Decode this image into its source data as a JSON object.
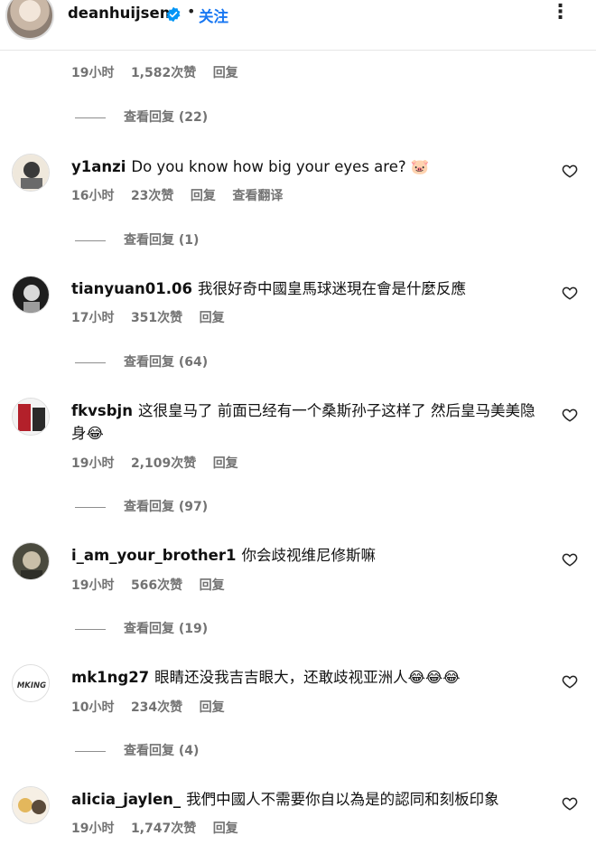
{
  "header": {
    "username": "deanhuijsen",
    "separator": "•",
    "follow_label": "关注",
    "more_icon": "more-icon"
  },
  "top_meta": {
    "time": "19小时",
    "likes": "1,582次赞",
    "reply": "回复"
  },
  "top_view_replies": "查看回复 (22)",
  "comments": [
    {
      "username": "y1anzi",
      "text": "Do you know how big your eyes are? 🐷",
      "time": "16小时",
      "likes": "23次赞",
      "reply": "回复",
      "translate": "查看翻译",
      "view_replies": "查看回复 (1)"
    },
    {
      "username": "tianyuan01.06",
      "text": "我很好奇中國皇馬球迷現在會是什麼反應",
      "time": "17小时",
      "likes": "351次赞",
      "reply": "回复",
      "view_replies": "查看回复 (64)"
    },
    {
      "username": "fkvsbjn",
      "text": "这很皇马了 前面已经有一个桑斯孙子这样了 然后皇马美美隐身😂",
      "time": "19小时",
      "likes": "2,109次赞",
      "reply": "回复",
      "view_replies": "查看回复 (97)"
    },
    {
      "username": "i_am_your_brother1",
      "text": "你会歧视维尼修斯嘛",
      "time": "19小时",
      "likes": "566次赞",
      "reply": "回复",
      "view_replies": "查看回复 (19)"
    },
    {
      "username": "mk1ng27",
      "text": "眼睛还没我吉吉眼大，还敢歧视亚洲人😂😂😂",
      "time": "10小时",
      "likes": "234次赞",
      "reply": "回复",
      "view_replies": "查看回复 (4)"
    },
    {
      "username": "alicia_jaylen_",
      "text": "我們中國人不需要你自以為是的認同和刻板印象",
      "time": "19小时",
      "likes": "1,747次赞",
      "reply": "回复"
    }
  ],
  "avatar_labels": {
    "mk1ng27": "MKING"
  },
  "colors": {
    "follow": "#1877f2",
    "meta": "#737373",
    "verified": "#0095f6"
  }
}
